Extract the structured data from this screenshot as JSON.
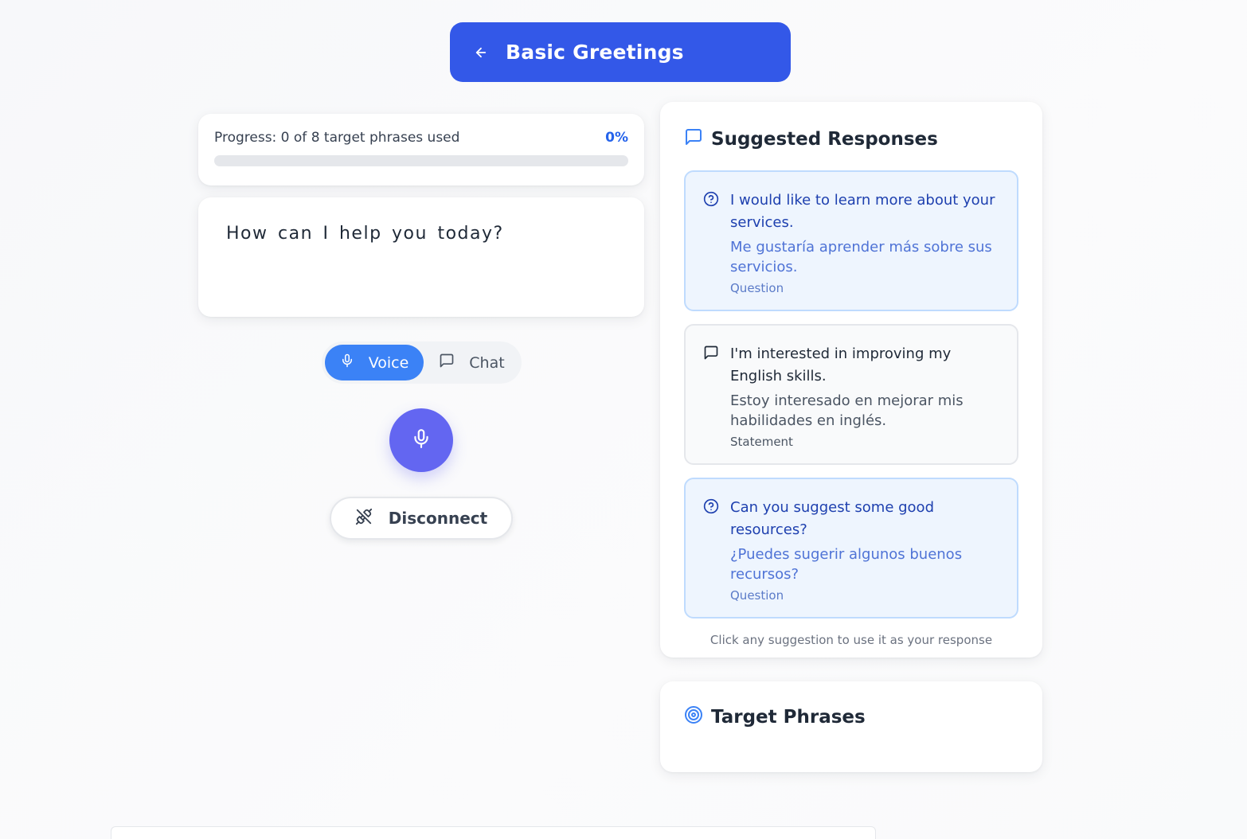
{
  "header": {
    "title": "Basic Greetings",
    "back_icon": "arrow-left-icon"
  },
  "progress": {
    "label": "Progress: 0 of 8 target phrases used",
    "percent_label": "0%",
    "fraction": 0,
    "color": "#3b82f6"
  },
  "prompt": {
    "text": "How can I help you today?"
  },
  "mode_toggle": {
    "voice_label": "Voice",
    "voice_icon": "microphone-icon",
    "chat_label": "Chat",
    "chat_icon": "chat-bubble-icon",
    "active": "voice",
    "active_color": "#3b82f6"
  },
  "mic_button": {
    "icon": "microphone-icon",
    "color": "#6366f1"
  },
  "disconnect": {
    "label": "Disconnect",
    "icon": "unplug-icon"
  },
  "suggested": {
    "title": "Suggested Responses",
    "title_icon": "message-square-icon",
    "items": [
      {
        "text": "I would like to learn more about your services.",
        "translation": "Me gustaría aprender más sobre sus servicios.",
        "type": "Question",
        "icon": "help-circle-icon"
      },
      {
        "text": "I'm interested in improving my English skills.",
        "translation": "Estoy interesado en mejorar mis habilidades en inglés.",
        "type": "Statement",
        "icon": "message-square-icon"
      },
      {
        "text": "Can you suggest some good resources?",
        "translation": "¿Puedes sugerir algunos buenos recursos?",
        "type": "Question",
        "icon": "help-circle-icon"
      }
    ],
    "hint": "Click any suggestion to use it as your response"
  },
  "target_phrases": {
    "title": "Target Phrases",
    "title_icon": "target-icon"
  },
  "colors": {
    "header_bg": "#3358e8",
    "question_bg": "#eef5fe",
    "question_border": "#bfdbfe",
    "statement_bg": "#f9fafb"
  }
}
